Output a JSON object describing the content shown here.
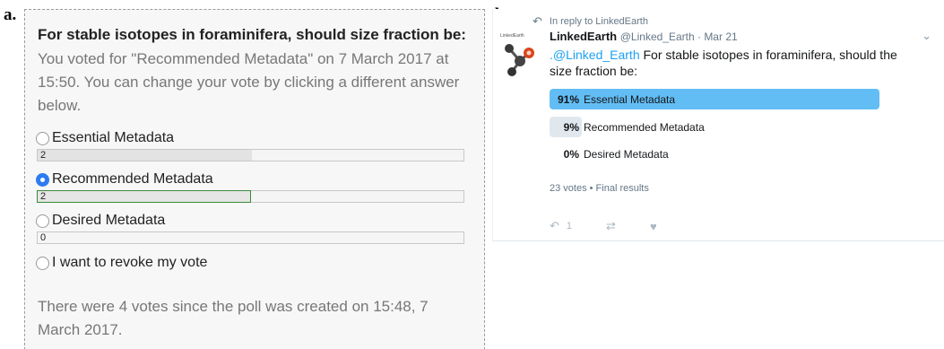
{
  "panel_labels": {
    "a": "a.",
    "b": "b."
  },
  "poll_a": {
    "question": "For stable isotopes in foraminifera, should size fraction be:",
    "voted_info": "You voted for \"Recommended Metadata\" on 7 March 2017 at 15:50. You can change your vote by clicking a different answer below.",
    "options": [
      {
        "label": "Essential Metadata",
        "votes": "2",
        "fraction": 0.5,
        "checked": false
      },
      {
        "label": "Recommended Metadata",
        "votes": "2",
        "fraction": 0.5,
        "checked": true
      },
      {
        "label": "Desired Metadata",
        "votes": "0",
        "fraction": 0,
        "checked": false
      }
    ],
    "revoke_label": "I want to revoke my vote",
    "summary": "There were 4 votes since the poll was created on 15:48, 7 March 2017."
  },
  "tweet": {
    "reply_text": "In reply to LinkedEarth",
    "name": "LinkedEarth",
    "meta": "@Linked_Earth · Mar 21",
    "mention": ".@Linked_Earth",
    "text": " For stable isotopes in foraminifera, should the size fraction be:",
    "options": [
      {
        "percent": "91%",
        "label": "Essential Metadata",
        "fraction": 0.91,
        "winner": true
      },
      {
        "percent": "9%",
        "label": "Recommended Metadata",
        "fraction": 0.09,
        "winner": false
      },
      {
        "percent": "0%",
        "label": "Desired Metadata",
        "fraction": 0,
        "winner": false
      }
    ],
    "footer": "23 votes • Final results",
    "reply_count": "1",
    "colors": {
      "winner_bar": "#62bdf4",
      "other_bar": "#e1e8ed",
      "link": "#1da1f2"
    }
  }
}
